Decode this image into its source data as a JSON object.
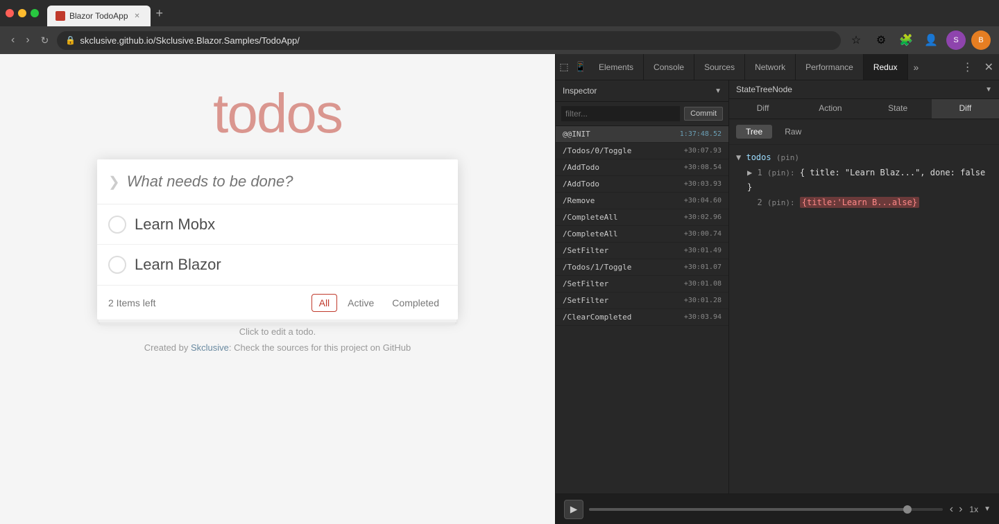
{
  "browser": {
    "tab_label": "Blazor TodoApp",
    "url": "skclusive.github.io/Skclusive.Blazor.Samples/TodoApp/",
    "new_tab_label": "+"
  },
  "todo_app": {
    "title": "todos",
    "input_placeholder": "What needs to be done?",
    "toggle_all_symbol": "❯",
    "items": [
      {
        "id": 1,
        "text": "Learn Mobx",
        "done": false
      },
      {
        "id": 2,
        "text": "Learn Blazor",
        "done": false
      }
    ],
    "items_left_label": "2 Items left",
    "filter_all": "All",
    "filter_active": "Active",
    "filter_completed": "Completed",
    "hint": "Click to edit a todo.",
    "credit_text": "Created by ",
    "credit_link_text": "Skclusive",
    "credit_suffix": ": Check the sources for this project on GitHub"
  },
  "devtools": {
    "tabs": [
      {
        "id": "elements",
        "label": "Elements"
      },
      {
        "id": "console",
        "label": "Console"
      },
      {
        "id": "sources",
        "label": "Sources"
      },
      {
        "id": "network",
        "label": "Network"
      },
      {
        "id": "performance",
        "label": "Performance"
      },
      {
        "id": "redux",
        "label": "Redux",
        "active": true
      },
      {
        "id": "more",
        "label": "»"
      }
    ],
    "inspector": {
      "title": "Inspector",
      "filter_placeholder": "filter...",
      "commit_label": "Commit",
      "actions": [
        {
          "id": 1,
          "name": "@@INIT",
          "time": "1:37:48.52",
          "is_init": true
        },
        {
          "id": 2,
          "name": "/Todos/0/Toggle",
          "time": "+30:07.93"
        },
        {
          "id": 3,
          "name": "/AddTodo",
          "time": "+30:08.54"
        },
        {
          "id": 4,
          "name": "/AddTodo",
          "time": "+30:03.93"
        },
        {
          "id": 5,
          "name": "/Remove",
          "time": "+30:04.60"
        },
        {
          "id": 6,
          "name": "/CompleteAll",
          "time": "+30:02.96"
        },
        {
          "id": 7,
          "name": "/CompleteAll",
          "time": "+30:00.74"
        },
        {
          "id": 8,
          "name": "/SetFilter",
          "time": "+30:01.49"
        },
        {
          "id": 9,
          "name": "/Todos/1/Toggle",
          "time": "+30:01.07"
        },
        {
          "id": 10,
          "name": "/SetFilter",
          "time": "+30:01.08"
        },
        {
          "id": 11,
          "name": "/SetFilter",
          "time": "+30:01.28"
        },
        {
          "id": 12,
          "name": "/ClearCompleted",
          "time": "+30:03.94"
        }
      ]
    },
    "state_panel": {
      "title": "StateTreeNode",
      "sub_tabs": [
        {
          "id": "diff",
          "label": "Diff"
        },
        {
          "id": "action",
          "label": "Action"
        },
        {
          "id": "state",
          "label": "State"
        },
        {
          "id": "diff2",
          "label": "Diff",
          "active": true
        }
      ],
      "view_tabs": [
        {
          "id": "tree",
          "label": "Tree",
          "active": true
        },
        {
          "id": "raw",
          "label": "Raw"
        }
      ],
      "tree": {
        "root_key": "todos",
        "root_pin": "(pin)",
        "item1_prefix": "1",
        "item1_pin": "(pin):",
        "item1_value": "{ title: \"Learn Blaz...\", done: false }",
        "item2_prefix": "2",
        "item2_pin": "(pin):",
        "item2_value": "{title:'Learn B...alse}",
        "item2_highlighted": true
      }
    },
    "bottom": {
      "play_symbol": "▶",
      "speed_label": "1x",
      "prev_symbol": "‹",
      "next_symbol": "›",
      "timeline_fill_percent": 90
    }
  }
}
